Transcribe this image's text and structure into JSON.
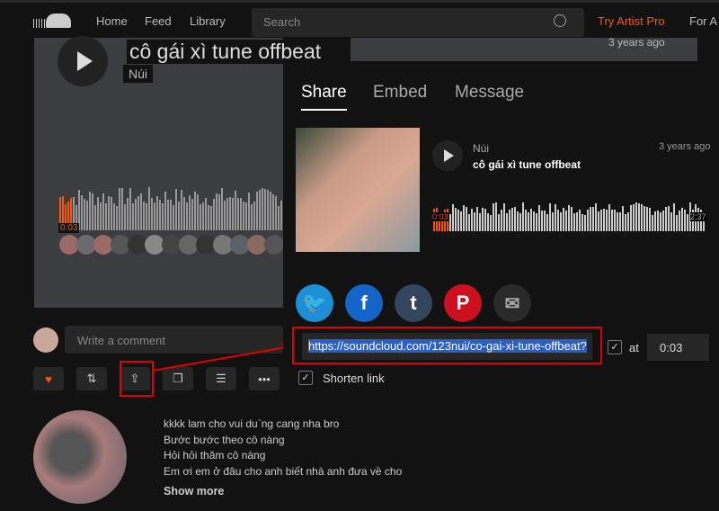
{
  "nav": {
    "home": "Home",
    "feed": "Feed",
    "library": "Library",
    "search_placeholder": "Search",
    "try_pro": "Try Artist Pro",
    "for_artists": "For A"
  },
  "track": {
    "title": "cô gái xì tune offbeat",
    "artist": "Núi",
    "age": "3 years ago",
    "position": "0:03",
    "duration": "2:37",
    "progress": 0.02
  },
  "comment": {
    "placeholder": "Write a comment"
  },
  "actions": [
    "like",
    "repost",
    "share",
    "copy",
    "add-to-playlist",
    "more"
  ],
  "share": {
    "tabs": [
      "Share",
      "Embed",
      "Message"
    ],
    "active_tab": "Share",
    "socials": [
      {
        "name": "twitter",
        "color": "#1d8fd6"
      },
      {
        "name": "facebook",
        "color": "#1465c9"
      },
      {
        "name": "tumblr",
        "color": "#34465d"
      },
      {
        "name": "pinterest",
        "color": "#cc1020"
      },
      {
        "name": "email",
        "color": "#2a2a2a"
      }
    ],
    "url": "https://soundcloud.com/123nui/co-gai-xi-tune-offbeat?",
    "at_label": "at",
    "at_time": "0:03",
    "at_checked": true,
    "shorten_label": "Shorten link",
    "shorten_checked": true
  },
  "description": {
    "lines": [
      "kkkk lam cho vui du`ng cang nha bro",
      "Bước bước theo cô nàng",
      "Hỏi hỏi thăm cô nàng",
      "Em ơi em ở đâu cho anh biết nhà anh đưa về cho"
    ],
    "show_more": "Show more"
  },
  "colors": {
    "accent": "#ff5500",
    "highlight": "#e00000"
  }
}
